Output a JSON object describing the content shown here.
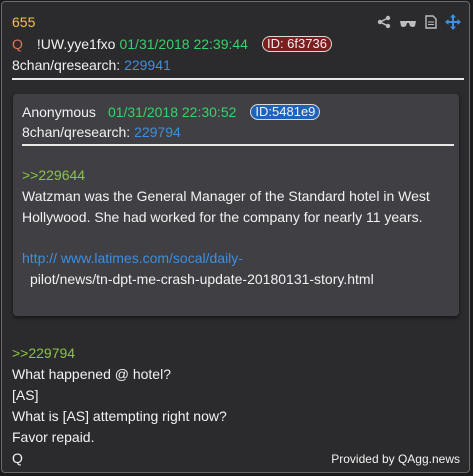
{
  "post": {
    "number": "655",
    "author": "Q",
    "tripcode": "!UW.yye1fxo",
    "datetime": "01/31/2018 22:39:44",
    "id": "ID: 6f3736",
    "board": "8chan/qresearch:",
    "post_id": "229941",
    "lines": [
      ">>229794",
      "What happened @ hotel?",
      "[AS]",
      "What is [AS] attempting right now?",
      "Favor repaid.",
      "Q"
    ]
  },
  "quoted": {
    "author": "Anonymous",
    "datetime": "01/31/2018 22:30:52",
    "id": "ID:5481e9",
    "board": "8chan/qresearch:",
    "post_id": "229794",
    "reply_ref": ">>229644",
    "body": "Watzman was the General Manager of the Standard hotel in West Hollywood. She had worked for the company for nearly 11 years.",
    "url_line1": "http:// www.latimes.com/socal/daily-",
    "url_line2": "pilot/news/tn-dpt-me-crash-update-20180131-story.html"
  },
  "icons": [
    "share-icon",
    "glasses-icon",
    "document-icon",
    "move-icon"
  ],
  "footer": "Provided by QAgg.news",
  "colors": {
    "number": "#f2c544",
    "date": "#39d16b",
    "link": "#3e8fe0",
    "greentext": "#8bc34a",
    "author_q": "#e0755a",
    "id_q_bg": "#7a1f1f",
    "id_anon_bg": "#1f63b8"
  }
}
